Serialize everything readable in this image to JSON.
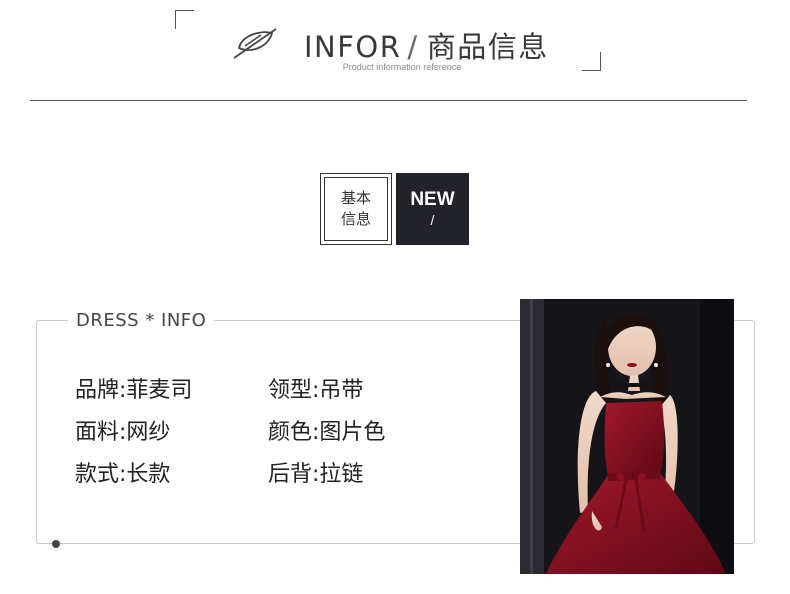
{
  "header": {
    "title_en": "INFOR",
    "slash": "/",
    "title_cn": "商品信息",
    "subtitle": "Product information reference"
  },
  "tags": {
    "basic_line1": "基本",
    "basic_line2": "信息",
    "new_label": "NEW",
    "new_slash": "/"
  },
  "info": {
    "legend": "DRESS * INFO",
    "fields": [
      {
        "label": "品牌:",
        "value": "菲麦司"
      },
      {
        "label": "领型:",
        "value": "吊带"
      },
      {
        "label": "面料:",
        "value": "网纱"
      },
      {
        "label": "颜色:",
        "value": "图片色"
      },
      {
        "label": "款式:",
        "value": "长款"
      },
      {
        "label": "后背:",
        "value": "拉链"
      }
    ]
  },
  "colors": {
    "dark_tag": "#22222a",
    "dress_red": "#8c0f22",
    "backdrop": "#151519"
  }
}
